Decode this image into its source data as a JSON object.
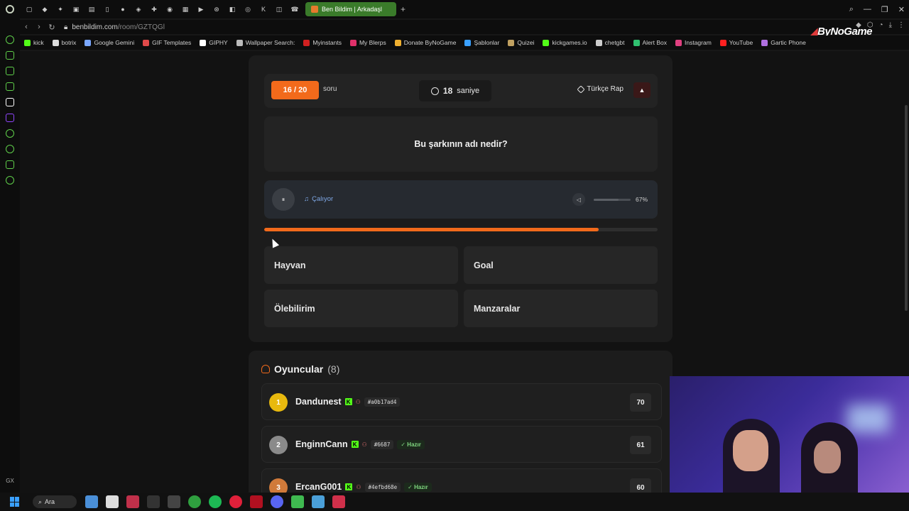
{
  "browser": {
    "active_tab_title": "Ben Bildim | Arkadaşl",
    "url_host": "benbildim.com",
    "url_path": "/room/GZTQGl",
    "brand": "ByNoGame",
    "bookmarks": [
      {
        "label": "kick",
        "color": "#53fc18"
      },
      {
        "label": "botrix",
        "color": "#dddddd"
      },
      {
        "label": "Google Gemini",
        "color": "#7aa7ff"
      },
      {
        "label": "GIF Templates",
        "color": "#e04a4a"
      },
      {
        "label": "GIPHY",
        "color": "#ffffff"
      },
      {
        "label": "Wallpaper Search:",
        "color": "#bbbbbb"
      },
      {
        "label": "Myinstants",
        "color": "#d02020"
      },
      {
        "label": "My Blerps",
        "color": "#e0306a"
      },
      {
        "label": "Donate ByNoGame",
        "color": "#f0b030"
      },
      {
        "label": "Şablonlar",
        "color": "#3aa0ff"
      },
      {
        "label": "Quizei",
        "color": "#c0a060"
      },
      {
        "label": "kickgames.io",
        "color": "#53fc18"
      },
      {
        "label": "chetgbt",
        "color": "#cccccc"
      },
      {
        "label": "Alert Box",
        "color": "#30c070"
      },
      {
        "label": "Instagram",
        "color": "#e04080"
      },
      {
        "label": "YouTube",
        "color": "#ff2020"
      },
      {
        "label": "Gartic Phone",
        "color": "#b070e0"
      }
    ],
    "sidebar_bottom_label": "GX"
  },
  "quiz": {
    "question_counter": "16 / 20",
    "counter_suffix": "soru",
    "timer_value": "18",
    "timer_unit": "saniye",
    "category": "Türkçe Rap",
    "report_icon": "▲",
    "question": "Bu şarkının adı nedir?",
    "player": {
      "pause_icon": "⏸",
      "status": "Çalıyor",
      "volume_label": "67%",
      "volume_level": 0.67
    },
    "time_progress": 0.85,
    "answers": [
      "Hayvan",
      "Goal",
      "Ölebilirim",
      "Manzaralar"
    ],
    "accent_color": "#f26a1b"
  },
  "players": {
    "title": "Oyuncular",
    "count_label": "(8)",
    "list": [
      {
        "rank": "1",
        "name": "Dandunest",
        "id": "#a0b17ad4",
        "ready": "",
        "score": "70",
        "rank_color": "#e8b90e"
      },
      {
        "rank": "2",
        "name": "EnginnCann",
        "id": "#6687",
        "ready": "Hazır",
        "score": "61",
        "rank_color": "#8a8a8a"
      },
      {
        "rank": "3",
        "name": "ErcanG001",
        "id": "#4efbd68e",
        "ready": "Hazır",
        "score": "60",
        "rank_color": "#d07a3a"
      }
    ]
  },
  "taskbar": {
    "search_label": "Ara"
  }
}
